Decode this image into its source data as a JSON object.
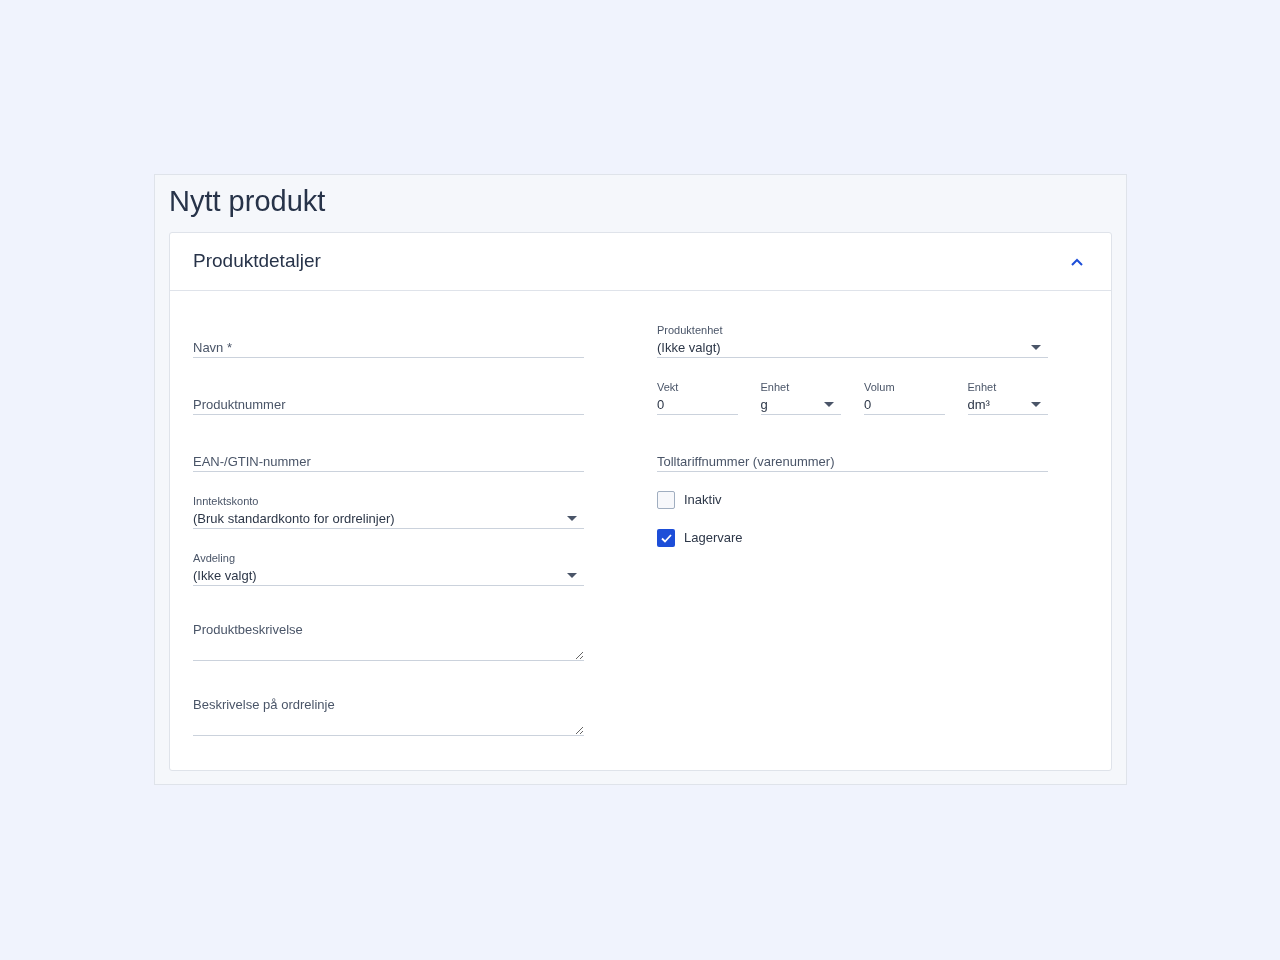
{
  "page": {
    "title": "Nytt produkt"
  },
  "section": {
    "title": "Produktdetaljer",
    "expanded": true
  },
  "left_fields": [
    {
      "kind": "text",
      "placeholder": "Navn *"
    },
    {
      "kind": "text",
      "placeholder": "Produktnummer"
    },
    {
      "kind": "text",
      "placeholder": "EAN-/GTIN-nummer"
    },
    {
      "kind": "select",
      "label": "Inntektskonto",
      "value": "(Bruk standardkonto for ordrelinjer)"
    },
    {
      "kind": "select",
      "label": "Avdeling",
      "value": "(Ikke valgt)"
    },
    {
      "kind": "textarea",
      "placeholder": "Produktbeskrivelse"
    },
    {
      "kind": "textarea",
      "placeholder": "Beskrivelse på ordrelinje"
    }
  ],
  "right_fields": [
    {
      "kind": "select",
      "label": "Produktenhet",
      "value": "(Ikke valgt)"
    },
    {
      "kind": "row",
      "fields": [
        {
          "kind": "number",
          "label": "Vekt",
          "value": "0"
        },
        {
          "kind": "select",
          "label": "Enhet",
          "value": "g"
        },
        {
          "kind": "number",
          "label": "Volum",
          "value": "0"
        },
        {
          "kind": "select",
          "label": "Enhet",
          "value": "dm³"
        }
      ]
    },
    {
      "kind": "text",
      "placeholder": "Tolltariffnummer (varenummer)"
    },
    {
      "kind": "checkbox",
      "label": "Inaktiv",
      "checked": false
    },
    {
      "kind": "checkbox",
      "label": "Lagervare",
      "checked": true
    }
  ]
}
